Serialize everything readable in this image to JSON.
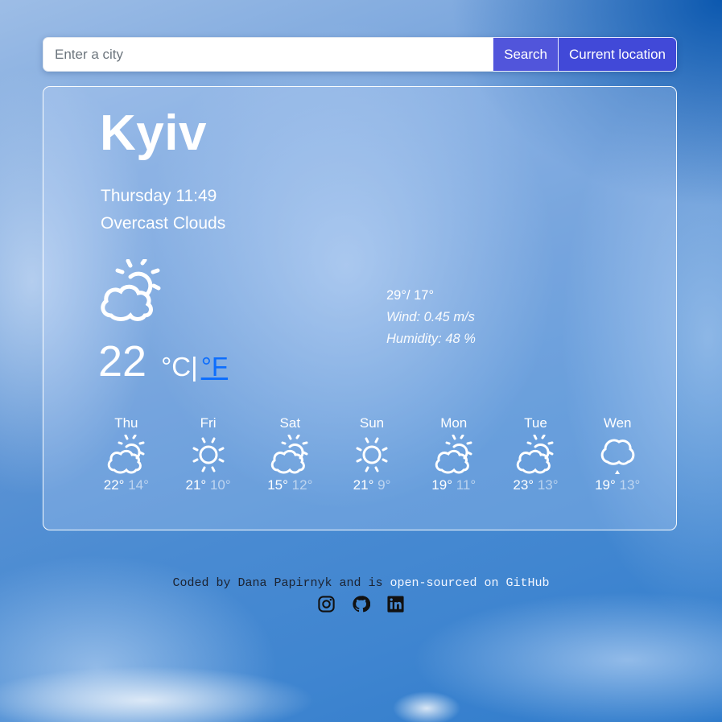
{
  "search": {
    "placeholder": "Enter a city",
    "value": "",
    "search_label": "Search",
    "location_label": "Current location"
  },
  "current": {
    "city": "Kyiv",
    "datetime": "Thursday 11:49",
    "description": "Overcast Clouds",
    "icon": "partly-cloudy-icon",
    "temperature": "22",
    "unit_celsius": "°C|",
    "unit_fahrenheit": "°F",
    "high_low": "29°/ 17°",
    "wind": "Wind: 0.45 m/s",
    "humidity": "Humidity: 48 %"
  },
  "forecast": [
    {
      "day": "Thu",
      "icon": "partly-cloudy-icon",
      "max": "22°",
      "min": "14°"
    },
    {
      "day": "Fri",
      "icon": "sun-icon",
      "max": "21°",
      "min": "10°"
    },
    {
      "day": "Sat",
      "icon": "partly-cloudy-icon",
      "max": "15°",
      "min": "12°"
    },
    {
      "day": "Sun",
      "icon": "sun-icon",
      "max": "21°",
      "min": "9°"
    },
    {
      "day": "Mon",
      "icon": "partly-cloudy-icon",
      "max": "19°",
      "min": "11°"
    },
    {
      "day": "Tue",
      "icon": "partly-cloudy-icon",
      "max": "23°",
      "min": "13°"
    },
    {
      "day": "Wen",
      "icon": "rain-cloud-icon",
      "max": "19°",
      "min": "13°"
    }
  ],
  "footer": {
    "text": "Coded by Dana Papirnyk and is ",
    "link_text": "open-sourced on GitHub",
    "socials": [
      "instagram-icon",
      "github-icon",
      "linkedin-icon"
    ]
  },
  "colors": {
    "button": "#4149d8",
    "link_fahrenheit": "#0d6efd"
  }
}
